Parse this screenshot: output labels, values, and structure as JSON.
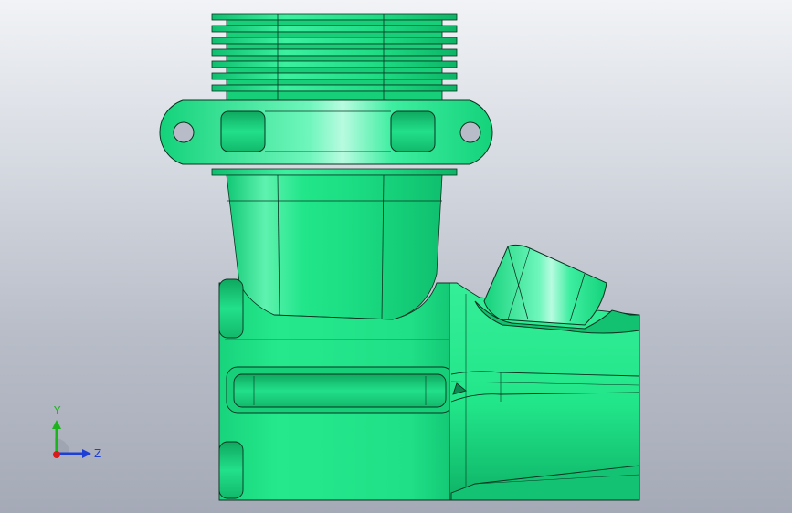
{
  "viewport": {
    "background_top": "#f1f3f6",
    "background_bottom": "#a5aab7"
  },
  "model": {
    "body_color": "#22e68a",
    "shade_color": "#0cb868",
    "highlight_color": "#7ff5c2",
    "edge_color": "#0a3320"
  },
  "triad": {
    "y_label": "Y",
    "z_label": "Z",
    "y_color": "#1db31d",
    "z_color": "#1e3fd6",
    "origin_color": "#d81b1b"
  }
}
